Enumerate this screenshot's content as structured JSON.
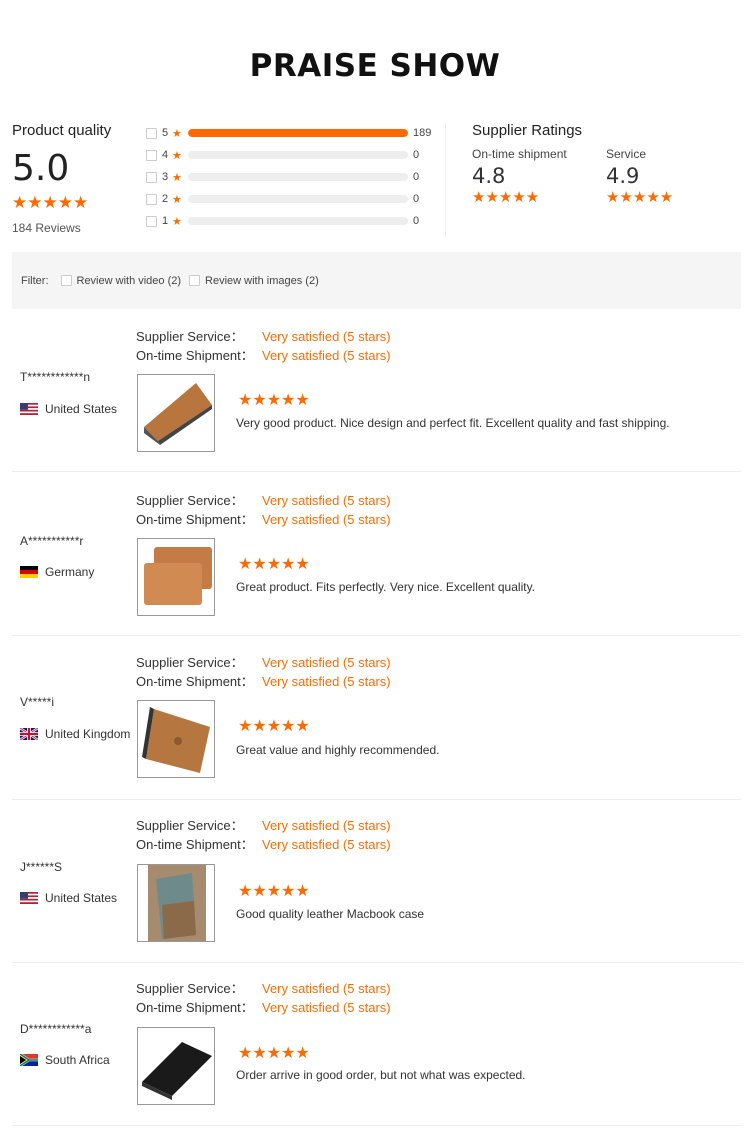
{
  "page_title": "PRAISE SHOW",
  "product_quality": {
    "label": "Product quality",
    "score": "5.0",
    "stars": "★★★★★",
    "reviews_count": "184 Reviews"
  },
  "distribution": [
    {
      "star": "5",
      "count": "189",
      "fraction": 1.0
    },
    {
      "star": "4",
      "count": "0",
      "fraction": 0
    },
    {
      "star": "3",
      "count": "0",
      "fraction": 0
    },
    {
      "star": "2",
      "count": "0",
      "fraction": 0
    },
    {
      "star": "1",
      "count": "0",
      "fraction": 0
    }
  ],
  "supplier_ratings": {
    "title": "Supplier Ratings",
    "items": [
      {
        "label": "On-time shipment",
        "value": "4.8",
        "stars": "★★★★★"
      },
      {
        "label": "Service",
        "value": "4.9",
        "stars": "★★★★★"
      }
    ]
  },
  "filter": {
    "label": "Filter:",
    "option_video": "Review with video (2)",
    "option_images": "Review with images (2)"
  },
  "colors": {
    "accent": "#ff6a00"
  },
  "review_labels": {
    "supplier_service": "Supplier Service：",
    "ontime_shipment": "On-time Shipment："
  },
  "reviews": [
    {
      "user": "T************n",
      "country": "United States",
      "flag": "us",
      "service": "Very satisfied (5 stars)",
      "shipment": "Very satisfied (5 stars)",
      "stars": "★★★★★",
      "text": "Very good product. Nice design and perfect fit. Excellent quality and fast shipping."
    },
    {
      "user": "A***********r",
      "country": "Germany",
      "flag": "de",
      "service": "Very satisfied (5 stars)",
      "shipment": "Very satisfied (5 stars)",
      "stars": "★★★★★",
      "text": "Great product. Fits perfectly. Very nice. Excellent quality."
    },
    {
      "user": "V*****i",
      "country": "United Kingdom",
      "flag": "gb",
      "service": "Very satisfied (5 stars)",
      "shipment": "Very satisfied (5 stars)",
      "stars": "★★★★★",
      "text": "Great value and highly recommended."
    },
    {
      "user": "J******S",
      "country": "United States",
      "flag": "us",
      "service": "Very satisfied (5 stars)",
      "shipment": "Very satisfied (5 stars)",
      "stars": "★★★★★",
      "text": "Good quality leather Macbook case"
    },
    {
      "user": "D************a",
      "country": "South Africa",
      "flag": "za",
      "service": "Very satisfied (5 stars)",
      "shipment": "Very satisfied (5 stars)",
      "stars": "★★★★★",
      "text": "Order arrive in good order, but not what was expected."
    }
  ]
}
